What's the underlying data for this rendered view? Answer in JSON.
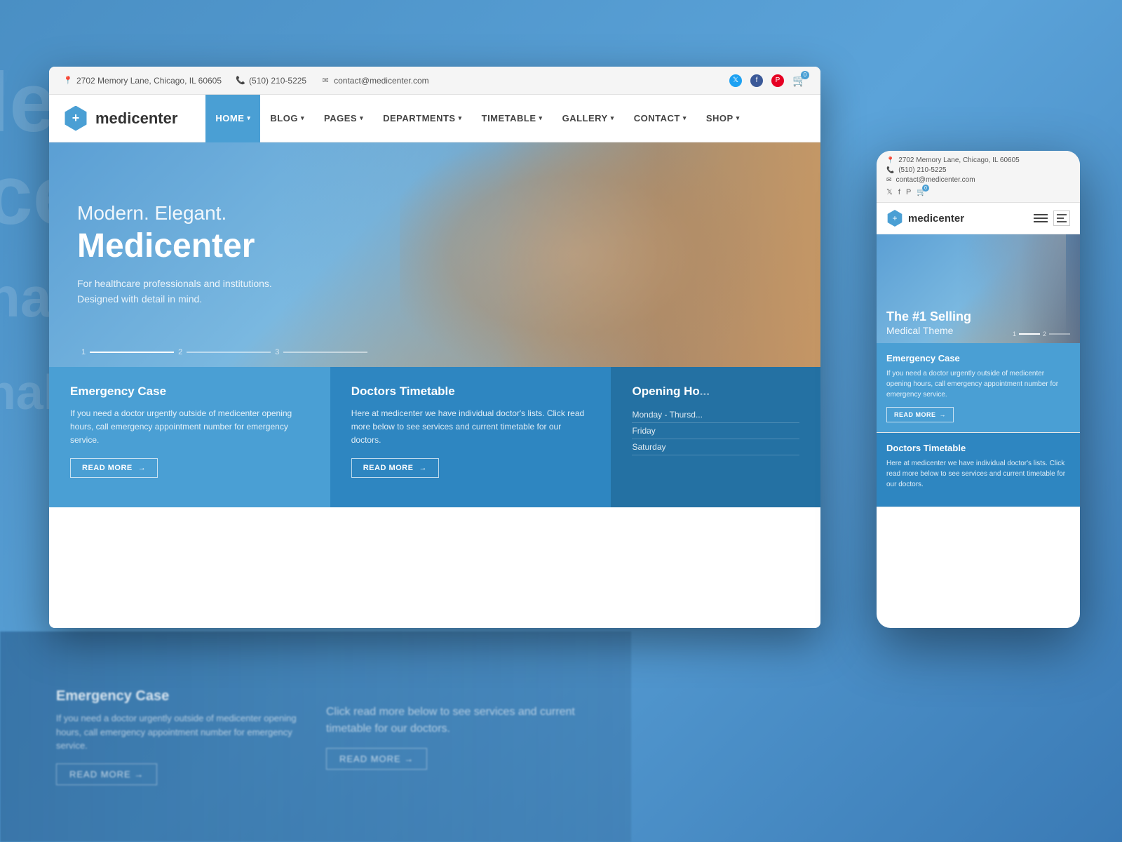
{
  "background": {
    "blur_texts": [
      "le",
      "ce",
      "nalis",
      "nalis",
      "side",
      "appointm",
      "ent number"
    ]
  },
  "desktop": {
    "top_bar": {
      "address": "2702 Memory Lane, Chicago, IL 60605",
      "phone": "(510) 210-5225",
      "email": "contact@medicenter.com",
      "social": [
        "twitter",
        "facebook",
        "pinterest"
      ],
      "cart_count": "0"
    },
    "nav": {
      "logo_text": "medicenter",
      "logo_symbol": "+",
      "items": [
        {
          "label": "HOME",
          "active": true,
          "has_arrow": true
        },
        {
          "label": "BLOG",
          "active": false,
          "has_arrow": true
        },
        {
          "label": "PAGES",
          "active": false,
          "has_arrow": true
        },
        {
          "label": "DEPARTMENTS",
          "active": false,
          "has_arrow": true
        },
        {
          "label": "TIMETABLE",
          "active": false,
          "has_arrow": true
        },
        {
          "label": "GALLERY",
          "active": false,
          "has_arrow": true
        },
        {
          "label": "CONTACT",
          "active": false,
          "has_arrow": true
        },
        {
          "label": "SHOP",
          "active": false,
          "has_arrow": true
        }
      ]
    },
    "hero": {
      "subtitle": "Modern. Elegant.",
      "title": "Medicenter",
      "description_line1": "For healthcare professionals and institutions.",
      "description_line2": "Designed with detail in mind.",
      "indicators": [
        "1",
        "2",
        "3"
      ]
    },
    "cards": [
      {
        "title": "Emergency Case",
        "text": "If you need a doctor urgently outside of medicenter opening hours, call emergency appointment number for emergency service.",
        "btn_label": "READ MORE",
        "type": "emergency"
      },
      {
        "title": "Doctors Timetable",
        "text": "Here at medicenter we have individual doctor's lists. Click read more below to see services and current timetable for our doctors.",
        "btn_label": "READ MORE",
        "type": "timetable"
      },
      {
        "title": "Opening Ho...",
        "hours": [
          {
            "day": "Monday - Thursd...",
            "time": ""
          },
          {
            "day": "Friday",
            "time": ""
          },
          {
            "day": "Saturday",
            "time": ""
          }
        ],
        "type": "hours"
      }
    ]
  },
  "mobile": {
    "top_bar": {
      "address": "2702 Memory Lane, Chicago, IL 60605",
      "phone": "(510) 210-5225",
      "email": "contact@medicenter.com",
      "social": [
        "twitter",
        "facebook",
        "pinterest"
      ],
      "cart_count": "0"
    },
    "nav": {
      "logo_text": "medicenter",
      "logo_symbol": "+"
    },
    "hero": {
      "title": "The #1 Selling",
      "subtitle": "Medical Theme",
      "indicators": [
        "1",
        "2"
      ]
    },
    "cards": [
      {
        "title": "Emergency Case",
        "text": "If you need a doctor urgently outside of medicenter opening hours, call emergency appointment number for emergency service.",
        "btn_label": "READ MORE",
        "type": "emergency"
      },
      {
        "title": "Doctors Timetable",
        "text": "Here at medicenter we have individual doctor's lists. Click read more below to see services and current timetable for our doctors.",
        "type": "timetable"
      }
    ]
  },
  "bg_bottom": {
    "cards": [
      {
        "title": "Emergency Case",
        "text": "If you need a doctor urgently outside of medicenter opening hours, call emergency appointment number for emergency service."
      },
      {
        "title": "",
        "text": "Click read more below to see services and current timetable for our doctors."
      }
    ]
  }
}
